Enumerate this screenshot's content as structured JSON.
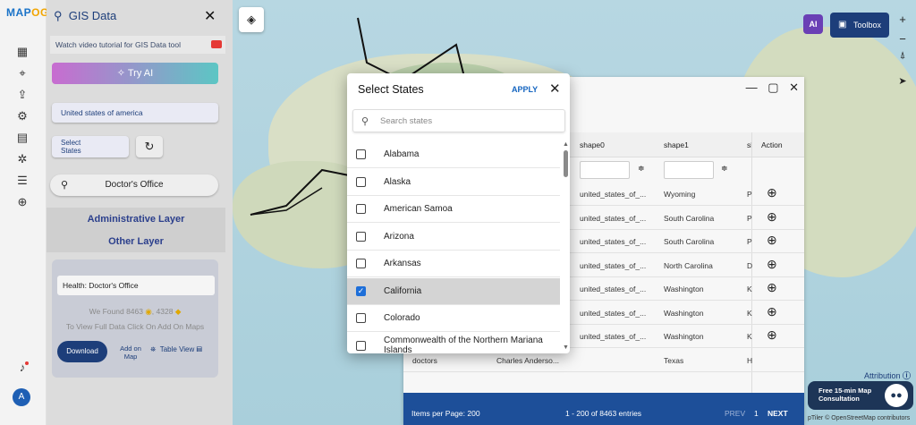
{
  "app": {
    "logo_a": "MAP",
    "logo_b": "OG"
  },
  "panel": {
    "title": "GIS Data",
    "video_tutorial": "Watch video tutorial for GIS Data tool",
    "try_ai": "Try AI",
    "country": "United states of america",
    "select_states_line1": "Select",
    "select_states_line2": "States",
    "search_value": "Doctor's Office",
    "administrative_layer": "Administrative Layer",
    "other_layer": "Other Layer",
    "category": "Health: Doctor's Office",
    "we_found": "We Found",
    "count_a": "8463",
    "count_b": "4328",
    "full_data_hint": "To View Full Data Click On Add On Maps",
    "download": "Download",
    "add_on_map_line1": "Add on",
    "add_on_map_line2": "Map",
    "table_view": "Table View"
  },
  "map_controls": {
    "toolbox": "Toolbox",
    "ai_badge": "AI",
    "attribution": "Attribution",
    "credit": "pTiler © OpenStreetMap contributors",
    "consult_line1": "Free 15-min Map",
    "consult_line2": "Consultation"
  },
  "table": {
    "headers": [
      "shape0",
      "shape1",
      "sl",
      "Action"
    ],
    "rows": [
      [
        "united_states_of_...",
        "Wyoming",
        "P"
      ],
      [
        "united_states_of_...",
        "South Carolina",
        "P"
      ],
      [
        "united_states_of_...",
        "South Carolina",
        "P"
      ],
      [
        "united_states_of_...",
        "North Carolina",
        "D"
      ],
      [
        "united_states_of_...",
        "Washington",
        "K"
      ],
      [
        "united_states_of_...",
        "Washington",
        "K"
      ],
      [
        "united_states_of_...",
        "Washington",
        "K"
      ]
    ],
    "partial_row": [
      "doctors",
      "Charles Anderso...",
      "Texas",
      "H"
    ],
    "items_per_page": "Items per Page: 200",
    "range": "1 - 200 of 8463 entries",
    "prev": "PREV",
    "page": "1",
    "next": "NEXT"
  },
  "modal": {
    "title": "Select States",
    "apply": "APPLY",
    "search_placeholder": "Search states",
    "items": [
      {
        "label": "Alabama",
        "checked": false
      },
      {
        "label": "Alaska",
        "checked": false
      },
      {
        "label": "American Samoa",
        "checked": false
      },
      {
        "label": "Arizona",
        "checked": false
      },
      {
        "label": "Arkansas",
        "checked": false
      },
      {
        "label": "California",
        "checked": true
      },
      {
        "label": "Colorado",
        "checked": false
      },
      {
        "label": "Commonwealth of the Northern Mariana Islands",
        "checked": false
      }
    ]
  }
}
